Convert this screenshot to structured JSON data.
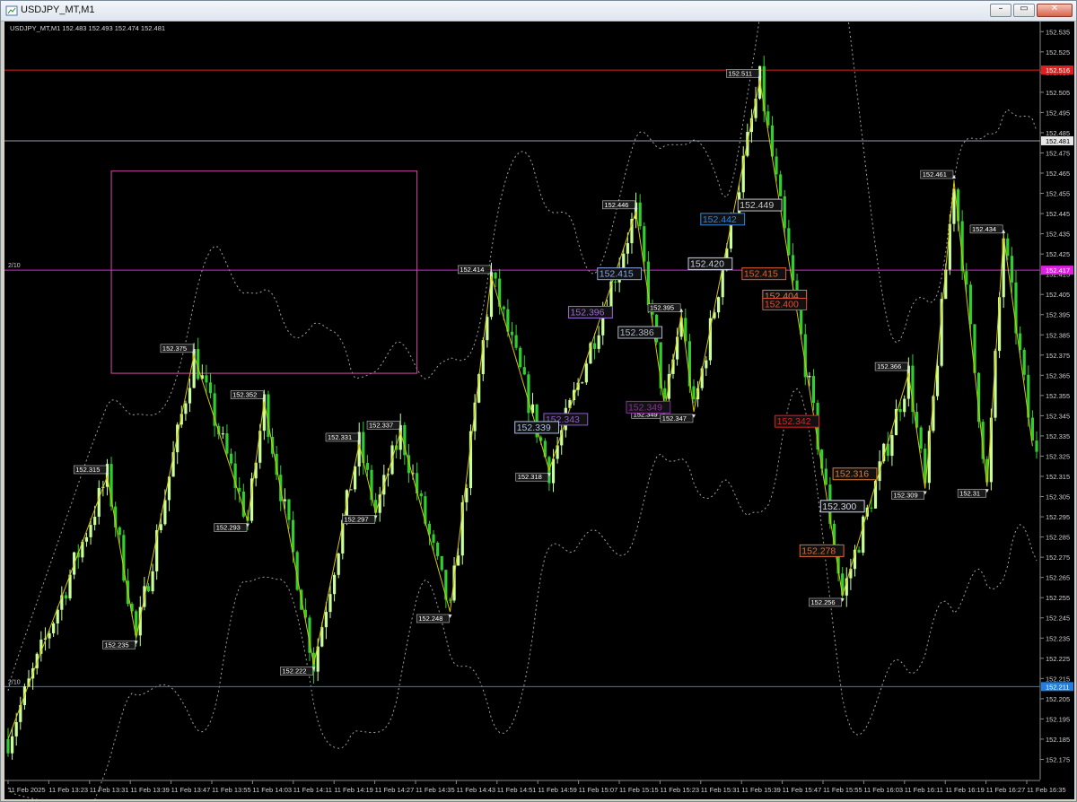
{
  "window": {
    "title": "USDJPY_MT,M1",
    "buttons": {
      "minimize": "–",
      "restore": "▭",
      "close": "✕"
    }
  },
  "chart_header": {
    "symbol_line": "USDJPY_MT,M1  152.483 152.493 152.474 152.481"
  },
  "colors": {
    "background": "#000000",
    "bull_candle": "#c8ff9a",
    "bear_candle": "#2fcf2f",
    "zigzag": "#d9c400",
    "bands": "#c8c8c8",
    "red_level": "#e02020",
    "magenta_level": "#e020e0",
    "blue_level": "#2080e0",
    "grey_level": "#9aa0a6",
    "box": "#d24ea6"
  },
  "chart_data": {
    "type": "candlestick",
    "title": "USDJPY_MT,M1",
    "ohlc_current": {
      "open": "152.483",
      "high": "152.493",
      "low": "152.474",
      "close": "152.481"
    },
    "ylim": [
      152.16,
      152.54
    ],
    "x_tick_labels": [
      "11 Feb 2025",
      "11 Feb 13:23",
      "11 Feb 13:31",
      "11 Feb 13:39",
      "11 Feb 13:47",
      "11 Feb 13:55",
      "11 Feb 14:03",
      "11 Feb 14:11",
      "11 Feb 14:19",
      "11 Feb 14:27",
      "11 Feb 14:35",
      "11 Feb 14:43",
      "11 Feb 14:51",
      "11 Feb 14:59",
      "11 Feb 15:07",
      "11 Feb 15:15",
      "11 Feb 15:23",
      "11 Feb 15:31",
      "11 Feb 15:39",
      "11 Feb 15:47",
      "11 Feb 15:55",
      "11 Feb 16:03",
      "11 Feb 16:11",
      "11 Feb 16:19",
      "11 Feb 16:27",
      "11 Feb 16:35"
    ],
    "y_tick_labels": [
      "152.535",
      "152.525",
      "152.515",
      "152.505",
      "152.495",
      "152.485",
      "152.475",
      "152.465",
      "152.455",
      "152.445",
      "152.435",
      "152.425",
      "152.415",
      "152.405",
      "152.395",
      "152.385",
      "152.375",
      "152.365",
      "152.355",
      "152.345",
      "152.335",
      "152.325",
      "152.315",
      "152.305",
      "152.295",
      "152.285",
      "152.275",
      "152.265",
      "152.255",
      "152.245",
      "152.235",
      "152.225",
      "152.215",
      "152.205",
      "152.195",
      "152.185",
      "152.175"
    ],
    "y_ticks": [
      152.535,
      152.53,
      152.525,
      152.52,
      152.515,
      152.51,
      152.505,
      152.5,
      152.495,
      152.49,
      152.485,
      152.48,
      152.475,
      152.47,
      152.465,
      152.46,
      152.455,
      152.45,
      152.445,
      152.44,
      152.435,
      152.43,
      152.425,
      152.42,
      152.415,
      152.41,
      152.405,
      152.4,
      152.395,
      152.39,
      152.385,
      152.38,
      152.375,
      152.37,
      152.365,
      152.36,
      152.355,
      152.35,
      152.345,
      152.34,
      152.335,
      152.33,
      152.325,
      152.32,
      152.315,
      152.31,
      152.305,
      152.3,
      152.295,
      152.29,
      152.285,
      152.28,
      152.275,
      152.27,
      152.265,
      152.26,
      152.255,
      152.25,
      152.245,
      152.24,
      152.235,
      152.23,
      152.225,
      152.22,
      152.215,
      152.21,
      152.205,
      152.2,
      152.195,
      152.19,
      152.185,
      152.18,
      152.175,
      152.17
    ],
    "horizontal_levels": [
      {
        "name": "red-level",
        "value": 152.516,
        "label": "152.516",
        "color": "#e02020"
      },
      {
        "name": "current-price",
        "value": 152.481,
        "label": "152.481",
        "color": "#9aa0a6"
      },
      {
        "name": "magenta-level",
        "value": 152.417,
        "label": "152.417",
        "color": "#e020e0",
        "left_label": "2/10"
      },
      {
        "name": "blue-level",
        "value": 152.211,
        "label": "152.211",
        "color": "#2080e0",
        "left_label": "2/10"
      }
    ],
    "zigzag_pivots": [
      {
        "t": 0,
        "v": 152.185,
        "label": ""
      },
      {
        "t": 24,
        "v": 152.315,
        "label": "152.315"
      },
      {
        "t": 31,
        "v": 152.235,
        "label": "152.235"
      },
      {
        "t": 45,
        "v": 152.375,
        "label": "152.375"
      },
      {
        "t": 58,
        "v": 152.293,
        "label": "152.293"
      },
      {
        "t": 62,
        "v": 152.352,
        "label": "152.352"
      },
      {
        "t": 74,
        "v": 152.222,
        "label": "152.222"
      },
      {
        "t": 85,
        "v": 152.331,
        "label": "152.331"
      },
      {
        "t": 89,
        "v": 152.297,
        "label": "152.297"
      },
      {
        "t": 95,
        "v": 152.337,
        "label": "152.337"
      },
      {
        "t": 107,
        "v": 152.248,
        "label": "152.248"
      },
      {
        "t": 117,
        "v": 152.414,
        "label": "152.414"
      },
      {
        "t": 131,
        "v": 152.318,
        "label": "152.318"
      },
      {
        "t": 152,
        "v": 152.446,
        "label": "152.446"
      },
      {
        "t": 159,
        "v": 152.349,
        "label": "152.349"
      },
      {
        "t": 163,
        "v": 152.395,
        "label": "152.395"
      },
      {
        "t": 166,
        "v": 152.347,
        "label": "152.347"
      },
      {
        "t": 182,
        "v": 152.511,
        "label": "152.511"
      },
      {
        "t": 202,
        "v": 152.256,
        "label": "152.256"
      },
      {
        "t": 218,
        "v": 152.366,
        "label": "152.366"
      },
      {
        "t": 222,
        "v": 152.309,
        "label": "152.309"
      },
      {
        "t": 229,
        "v": 152.461,
        "label": "152.461"
      },
      {
        "t": 237,
        "v": 152.31,
        "label": "152.31"
      },
      {
        "t": 241,
        "v": 152.434,
        "label": "152.434"
      },
      {
        "t": 248,
        "v": 152.33,
        "label": ""
      }
    ],
    "signal_labels": [
      {
        "text": "152.442",
        "t": 173,
        "v": 152.442,
        "color": "#2e86e6"
      },
      {
        "text": "152.449",
        "t": 182,
        "v": 152.449,
        "color": "#c8c8c8"
      },
      {
        "text": "152.415",
        "t": 148,
        "v": 152.415,
        "color": "#8aa8e6"
      },
      {
        "text": "152.420",
        "t": 170,
        "v": 152.42,
        "color": "#c8d0e0"
      },
      {
        "text": "152.415",
        "t": 183,
        "v": 152.415,
        "color": "#e06030"
      },
      {
        "text": "152.404",
        "t": 188,
        "v": 152.404,
        "color": "#e07a4a"
      },
      {
        "text": "152.400",
        "t": 188,
        "v": 152.4,
        "color": "#e05030"
      },
      {
        "text": "152.396",
        "t": 141,
        "v": 152.396,
        "color": "#9a6ad6"
      },
      {
        "text": "152.386",
        "t": 153,
        "v": 152.386,
        "color": "#b0b8c8"
      },
      {
        "text": "152.343",
        "t": 135,
        "v": 152.343,
        "color": "#8a5ad0"
      },
      {
        "text": "152.339",
        "t": 128,
        "v": 152.339,
        "color": "#a8c0e8"
      },
      {
        "text": "152.349",
        "t": 155,
        "v": 152.349,
        "color": "#8a30a0"
      },
      {
        "text": "152.342",
        "t": 191,
        "v": 152.342,
        "color": "#e02020"
      },
      {
        "text": "152.316",
        "t": 205,
        "v": 152.316,
        "color": "#e07a30"
      },
      {
        "text": "152.300",
        "t": 202,
        "v": 152.3,
        "color": "#d0d8e8"
      },
      {
        "text": "152.278",
        "t": 197,
        "v": 152.278,
        "color": "#e06a30"
      }
    ],
    "box": {
      "t0": 25,
      "t1": 99,
      "v_top": 152.466,
      "v_bottom": 152.366,
      "color": "#d24ea6"
    },
    "candle_count": 250,
    "grid": false
  }
}
